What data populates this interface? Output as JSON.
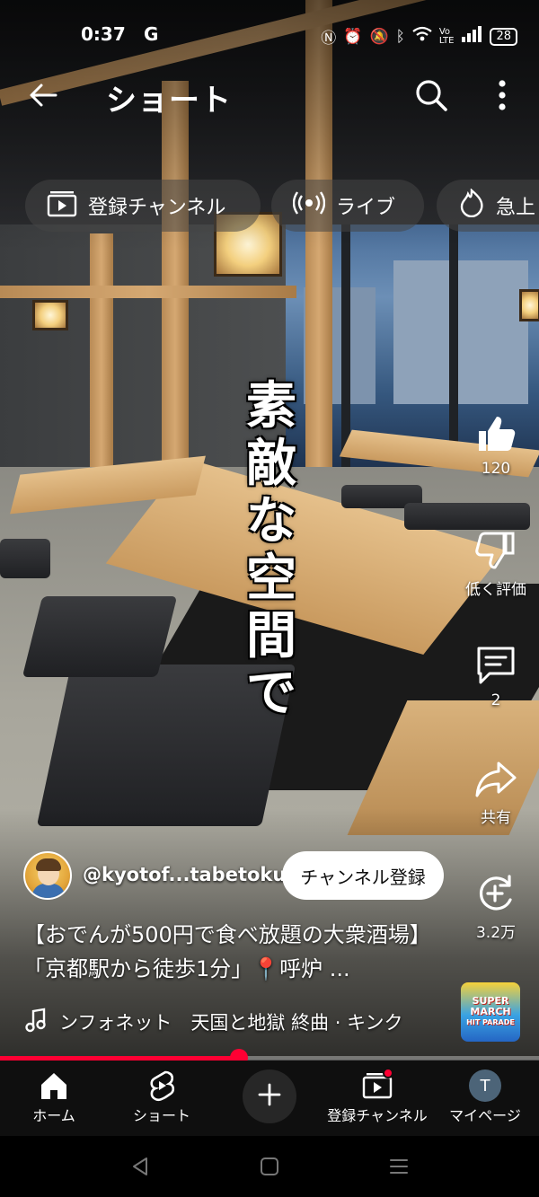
{
  "status_bar": {
    "time": "0:37",
    "g_label": "G",
    "battery": "28"
  },
  "header": {
    "title": "ショート"
  },
  "chips": [
    {
      "label": "登録チャンネル",
      "icon": "subscriptions-icon"
    },
    {
      "label": "ライブ",
      "icon": "live-icon"
    },
    {
      "label": "急上",
      "icon": "trending-icon"
    }
  ],
  "video": {
    "caption": "素敵な空間で"
  },
  "actions": {
    "like_count": "120",
    "dislike_label": "低く評価",
    "comment_count": "2",
    "share_label": "共有",
    "remix_count": "3.2万"
  },
  "channel": {
    "handle": "@kyotof...tabetoku",
    "subscribe_label": "チャンネル登録"
  },
  "title": {
    "text": "【おでんが500円で食べ放題の大衆酒場】「京都駅から徒歩1分」📍呼炉 ..."
  },
  "music": {
    "text": "ンフォネット　天国と地獄 終曲 · キンク"
  },
  "music_thumb": {
    "line1": "SUPER",
    "line2": "MARCH",
    "line3": "HIT PARADE"
  },
  "progress": {
    "fraction": 0.443
  },
  "bottom_nav": {
    "home": "ホーム",
    "shorts": "ショート",
    "subscriptions": "登録チャンネル",
    "you": "マイページ",
    "you_initial": "T"
  },
  "colors": {
    "accent": "#ff0033",
    "nav_bg": "#0f0f0f"
  }
}
